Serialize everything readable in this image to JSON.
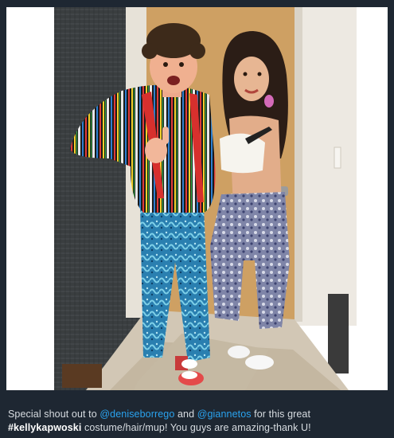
{
  "photo": {
    "icon": "photo-image",
    "subject": "two-people-costume-photo"
  },
  "caption": {
    "prefix": "Special shout out to ",
    "mention1": "@deniseborrego",
    "connector": " and ",
    "mention2": "@giannetos",
    "middle": " for this great",
    "hashtag": "#kellykapwoski",
    "suffix": " costume/hair/mup! You guys are amazing-thank U!"
  },
  "colors": {
    "background": "#1e2732",
    "link": "#2aa3ef",
    "text": "#d7dce1"
  }
}
